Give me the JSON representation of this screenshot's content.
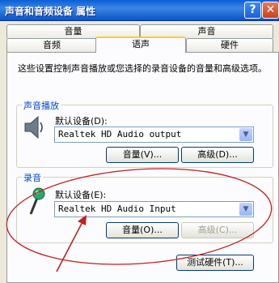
{
  "window": {
    "title": "声音和音频设备 属性",
    "help_label": "?",
    "close_label": "✕"
  },
  "tabs_top": [
    {
      "label": "音量"
    },
    {
      "label": "声音"
    }
  ],
  "tabs_bottom": [
    {
      "label": "音频"
    },
    {
      "label": "语声"
    },
    {
      "label": "硬件"
    }
  ],
  "description": "这些设置控制声音播放或您选择的录音设备的音量和高级选项。",
  "playback": {
    "group_label": "声音播放",
    "device_label": "默认设备(D):",
    "device_value": "Realtek HD Audio output",
    "volume_button": "音量(V)...",
    "advanced_button": "高级(D)..."
  },
  "recording": {
    "group_label": "录音",
    "device_label": "默认设备(E):",
    "device_value": "Realtek HD Audio Input",
    "volume_button": "音量(O)...",
    "advanced_button": "高级(C)..."
  },
  "test_hardware_button": "测试硬件(T)...",
  "colors": {
    "annotation": "#c02020",
    "title_bar": "#0a5fd7",
    "group_label": "#0046d5"
  }
}
